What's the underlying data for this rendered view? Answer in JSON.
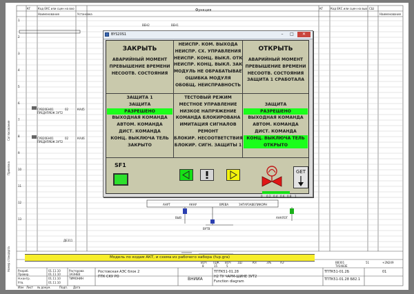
{
  "sheet": {
    "head_cols": [
      "КГ",
      "Код ЕКС или сцен на вхо",
      "Наименование",
      "Функция",
      "Код ЕКС или сцен на вых",
      "КГ",
      "СШ",
      "Наименование"
    ],
    "col_numbers": [
      "1",
      "2",
      "3",
      "4",
      "5",
      "6",
      "7",
      "8",
      "9",
      "10",
      "11",
      "12",
      "13"
    ],
    "state_label": "Установка",
    "left_signals": [
      {
        "code": "СУВ20ЕН01",
        "text": "ПРЕДУПРЕЖ ЗУТ2",
        "num": "02",
        "ref": "КА45"
      },
      {
        "code": "СУВ20ЕН01",
        "text": "ПРЕДУПРЕЖ ЗУТ2",
        "num": "02",
        "ref": "КА46"
      }
    ],
    "elements": [
      "ВЕН2",
      "ВЕН1",
      "ВЕН2",
      "ВЕН3",
      "ВЕН7",
      "ВЕН8",
      "АНУТ",
      "АКНУ",
      "ВРЕВА",
      "ЗНТАРЗАВЕЛИКОРН",
      "ВЫВ",
      "АНАЛОГ",
      "ВУТВ"
    ],
    "bottom_codes": [
      "ДЕ311",
      "CB275",
      "ВОЧ",
      "ТЦЖ",
      "ВОЧ",
      "1Ш",
      "КЯ",
      "ЗУЕ",
      "АЭ",
      "8",
      "15",
      "5"
    ],
    "strip_note": "Модель по кодам АКТ, и схема из рабочего набора (fup.gra)",
    "side_notes": [
      "Привязка",
      "Согласование",
      "Номер стандарта"
    ],
    "title_block": {
      "names": [
        "Разраб.",
        "Провер.",
        "Н.контр.",
        "Утв."
      ],
      "people": [
        "Расторова",
        "ЗАЗНЕВ",
        "ТИМОНИН"
      ],
      "dates": [
        "01.11.10",
        "01.11.10",
        "01.11.10",
        "01.11.10"
      ],
      "project": "Ростовская АЭС блок 2",
      "project2": "ПТК СКУ РО",
      "code": "ТПТК51-01.2Б",
      "code2": "ТПТК51-01.28 Б82.1",
      "stamp": "ВНИИА",
      "desc1": "ТПТК51-01.28",
      "desc2": "Н2 ТУ ЧАРМ-ШИНЕ ЗУТ2",
      "desc3": "Function diagram",
      "col_heads": [
        "Изм",
        "Лист",
        "№ докум.",
        "Подп.",
        "Дата"
      ],
      "sheet_num": "01",
      "right_code": "ВВЗ01",
      "right_code2": "ТУ2483Е",
      "right_code3": "+2N249",
      "frame_num": "51"
    }
  },
  "window": {
    "title": "BYS20S1",
    "min": "–",
    "max": "□",
    "close": "✕"
  },
  "panel": {
    "close_header": "ЗАКРЫТЬ",
    "open_header": "ОТКРЫТЬ",
    "left_top": [
      "АВАРИЙНЫЙ МОМЕНТ",
      "ПРЕВЫШЕНИЕ ВРЕМЕНИ",
      "НЕСООТВ. СОСТОЯНИЯ"
    ],
    "mid_top": [
      "НЕИСПР. КОМ. ВЫХОДА",
      "НЕИСПР. СХ. УПРАВЛЕНИЯ",
      "НЕИСПР. КОНЦ. ВЫКЛ. ОТКР",
      "НЕИСПР. КОНЦ. ВЫКЛ. ЗАКР.",
      "МОДУЛЬ НЕ ОБРАБАТЫВАЕТ",
      "ОШИБКА МОДУЛЯ",
      "ОБОБЩ. НЕИСПРАВНОСТЬ"
    ],
    "right_top": [
      "АВАРИЙНЫЙ МОМЕНТ",
      "ПРЕВЫШЕНИЕ ВРЕМЕНИ",
      "НЕСООТВ. СОСТОЯНИЯ",
      "ЗАЩИТА 1 СРАБОТАЛА"
    ],
    "left_bottom": [
      "ЗАЩИТА 1",
      "ЗАЩИТА",
      "РАЗРЕШЕНО",
      "ВЫХОДНАЯ КОМАНДА",
      "АВТОМ. КОМАНДА",
      "ДИСТ. КОМАНДА",
      "КОНЦ. ВЫКЛЮЧА ТЕЛЬ",
      "ЗАКРЫТО"
    ],
    "left_bottom_on": [
      false,
      false,
      true,
      false,
      false,
      false,
      false,
      false
    ],
    "mid_bottom": [
      "ТЕСТОВЫЙ РЕЖИМ",
      "МЕСТНОЕ УПРАВЛЕНИЕ",
      "НИЗКОЕ НАПРЯЖЕНИЕ",
      "КОМАНДА БЛОКИРОВАНА",
      "ИМИТАЦИЯ СИГНАЛОВ",
      "РЕМОНТ",
      "БЛОКИР. НЕСООТВЕТСТВИЯ",
      "БЛОКИР. СИГН. ЗАЩИТЫ 1"
    ],
    "right_bottom": [
      "",
      "ЗАЩИТА",
      "РАЗРЕШЕНО",
      "ВЫХОДНАЯ КОМАНДА",
      "АВТОМ. КОМАНДА",
      "ДИСТ. КОМАНДА",
      "КОНЦ. ВЫКЛЮЧА ТЕЛЬ",
      "ОТКРЫТО"
    ],
    "right_bottom_on": [
      false,
      false,
      true,
      false,
      false,
      false,
      true,
      true
    ],
    "sf1": "SF1",
    "btn_left": "◁",
    "btn_stop": "!",
    "btn_right": "▷",
    "scale": [
      "0",
      "0.2",
      "0.4",
      "0.6",
      "0.8",
      "1"
    ],
    "valve_position": 0.72,
    "get_label": "GET"
  }
}
